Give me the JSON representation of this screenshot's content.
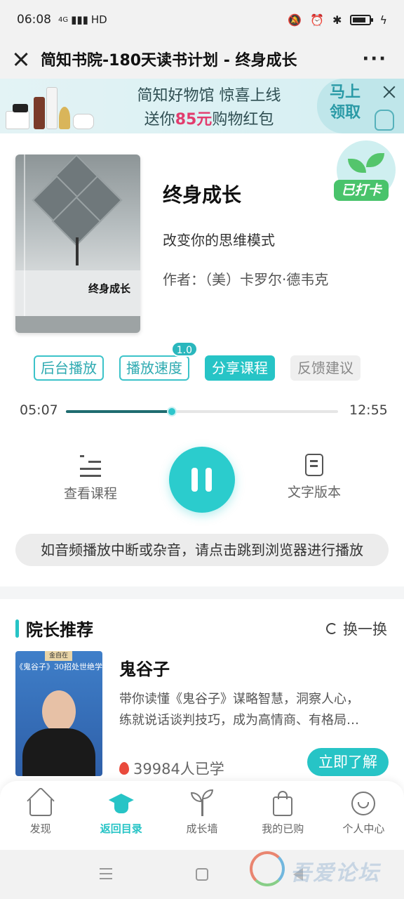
{
  "status_bar": {
    "time": "06:08",
    "network": "4G",
    "hd": "HD"
  },
  "title_bar": {
    "title": "简知书院-180天读书计划 - 终身成长",
    "more": "···"
  },
  "ad_banner": {
    "line1": "简知好物馆 惊喜上线",
    "line2_prefix": "送你",
    "line2_amount": "85元",
    "line2_suffix": "购物红包",
    "cta_line1": "马上",
    "cta_line2": "领取"
  },
  "book": {
    "cover_title": "终身成长",
    "title": "终身成长",
    "subtitle": "改变你的思维模式",
    "author": "作者：（美）卡罗尔·德韦克",
    "checkin_badge": "已打卡"
  },
  "actions": {
    "background_play": "后台播放",
    "playback_speed": "播放速度",
    "speed_value": "1.0",
    "share_course": "分享课程",
    "feedback": "反馈建议"
  },
  "player": {
    "current_time": "05:07",
    "total_time": "12:55",
    "progress": 0.39,
    "view_course": "查看课程",
    "text_version": "文字版本",
    "notice": "如音频播放中断或杂音，请点击跳到浏览器进行播放"
  },
  "recommend": {
    "section_title": "院长推荐",
    "refresh": "换一换",
    "cover_caption": "《鬼谷子》30招处世绝学",
    "cover_tag": "金自在",
    "name": "鬼谷子",
    "desc_line1": "带你读懂《鬼谷子》谋略智慧，洞察人心，",
    "desc_line2": "练就说话谈判技巧，成为高情商、有格局…",
    "learners": "39984人已学",
    "learn_button": "立即了解"
  },
  "bottom_nav": {
    "items": [
      {
        "label": "发现",
        "icon": "home-icon"
      },
      {
        "label": "返回目录",
        "icon": "graduation-cap-icon"
      },
      {
        "label": "成长墙",
        "icon": "sprout-icon"
      },
      {
        "label": "我的已购",
        "icon": "shopping-bag-icon"
      },
      {
        "label": "个人中心",
        "icon": "smiley-face-icon"
      }
    ]
  },
  "watermark": "吾爱论坛",
  "colors": {
    "accent": "#27c4c6",
    "accent_dark": "#1f6c70",
    "badge_green": "#49c36b",
    "price_red": "#e23c6e"
  }
}
